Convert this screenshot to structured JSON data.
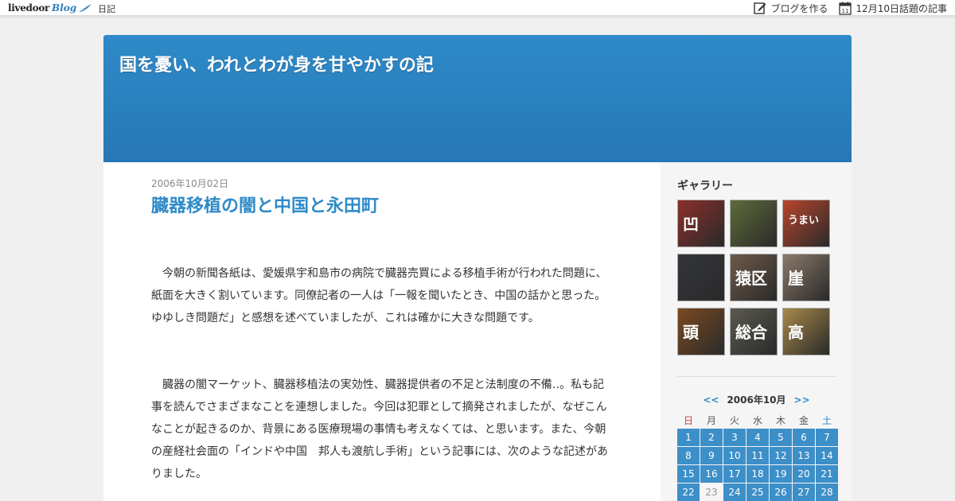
{
  "topbar": {
    "logo_main": "livedoor",
    "logo_sub": "Blog",
    "nav_link": "日記",
    "right_links": [
      {
        "label": "ブログを作る",
        "icon": "edit-icon"
      },
      {
        "label": "12月10日話題の記事",
        "icon": "calendar-icon",
        "icon_text": "11"
      }
    ]
  },
  "header": {
    "title": "国を憂い、われとわが身を甘やかすの記"
  },
  "post": {
    "date": "2006年10月02日",
    "title": "臓器移植の闇と中国と永田町",
    "paragraphs": [
      "今朝の新聞各紙は、愛媛県宇和島市の病院で臓器売買による移植手術が行われた問題に、紙面を大きく割いています。同僚記者の一人は「一報を聞いたとき、中国の話かと思った。ゆゆしき問題だ」と感想を述べていましたが、これは確かに大きな問題です。",
      "臓器の闇マーケット、臓器移植法の実効性、臓器提供者の不足と法制度の不備‥。私も記事を読んでさまざまなことを連想しました。今回は犯罪として摘発されましたが、なぜこんなことが起きるのか、背景にある医療現場の事情も考えなくては、と思います。また、今朝の産経社会面の「インドや中国　邦人も渡航し手術」という記事には、次のような記述がありました。"
    ]
  },
  "sidebar": {
    "gallery_heading": "ギャラリー",
    "gallery": [
      {
        "name": "gallery-thumb-1",
        "color": "#8b2f2a",
        "text": "凹"
      },
      {
        "name": "gallery-thumb-2",
        "color": "#5f6b3a",
        "text": ""
      },
      {
        "name": "gallery-thumb-3",
        "color": "#b8452c",
        "text": "うまい"
      },
      {
        "name": "gallery-thumb-4",
        "color": "#33353a",
        "text": ""
      },
      {
        "name": "gallery-thumb-5",
        "color": "#6e5a4a",
        "text": "猿区"
      },
      {
        "name": "gallery-thumb-6",
        "color": "#8a7a6a",
        "text": "崖"
      },
      {
        "name": "gallery-thumb-7",
        "color": "#7a4a20",
        "text": "頭"
      },
      {
        "name": "gallery-thumb-8",
        "color": "#5a5a50",
        "text": "総合"
      },
      {
        "name": "gallery-thumb-9",
        "color": "#a8894a",
        "text": "高"
      }
    ],
    "calendar": {
      "prev": "<<",
      "month": "2006年10月",
      "next": ">>",
      "weekdays": [
        "日",
        "月",
        "火",
        "水",
        "木",
        "金",
        "土"
      ],
      "days": [
        "1",
        "2",
        "3",
        "4",
        "5",
        "6",
        "7",
        "8",
        "9",
        "10",
        "11",
        "12",
        "13",
        "14",
        "15",
        "16",
        "17",
        "18",
        "19",
        "20",
        "21",
        "22",
        "23",
        "24",
        "25",
        "26",
        "27",
        "28"
      ],
      "no_post_days": [
        "23"
      ]
    }
  }
}
